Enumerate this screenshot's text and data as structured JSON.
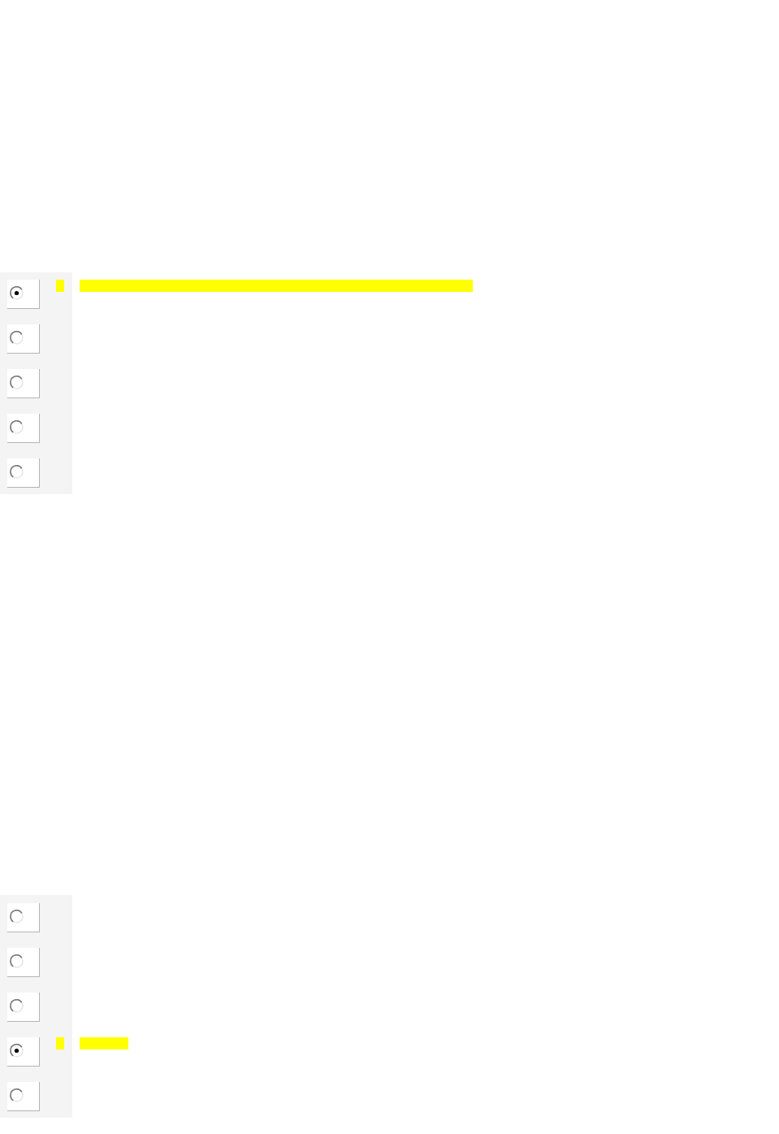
{
  "questions": [
    {
      "options": [
        {
          "selected": true,
          "highlighted": true
        },
        {
          "selected": false,
          "highlighted": false
        },
        {
          "selected": false,
          "highlighted": false
        },
        {
          "selected": false,
          "highlighted": false
        },
        {
          "selected": false,
          "highlighted": false
        }
      ]
    },
    {
      "options": [
        {
          "selected": false,
          "highlighted": false
        },
        {
          "selected": false,
          "highlighted": false
        },
        {
          "selected": false,
          "highlighted": false
        },
        {
          "selected": true,
          "highlighted": true
        },
        {
          "selected": false,
          "highlighted": false
        }
      ]
    }
  ]
}
